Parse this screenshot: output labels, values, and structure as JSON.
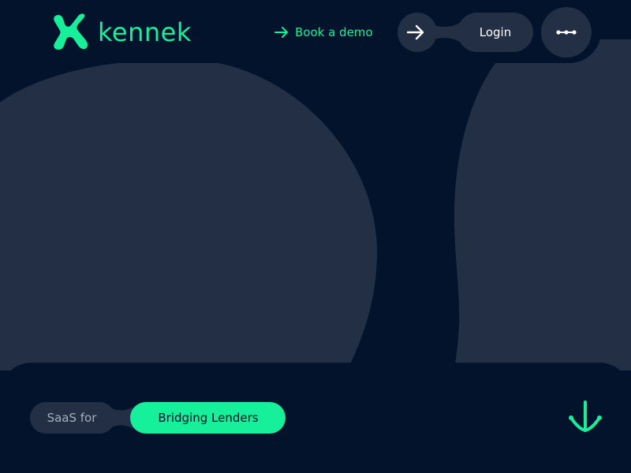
{
  "header": {
    "brand_name": "kennek",
    "book_demo_label": "Book a demo",
    "login_label": "Login",
    "icons": {
      "logo": "kennek-k-mark-icon",
      "book_demo": "arrow-right-icon",
      "login": "arrow-right-icon",
      "menu": "dots-menu-icon"
    }
  },
  "hero": {
    "tag_prefix": "SaaS for",
    "tag_highlight": "Bridging Lenders",
    "scroll_icon": "arrow-down-icon"
  },
  "colors": {
    "background": "#02132b",
    "shape": "#222f44",
    "accent": "#16f09a",
    "text_light": "#ffffff",
    "text_muted": "#a7afbe"
  }
}
